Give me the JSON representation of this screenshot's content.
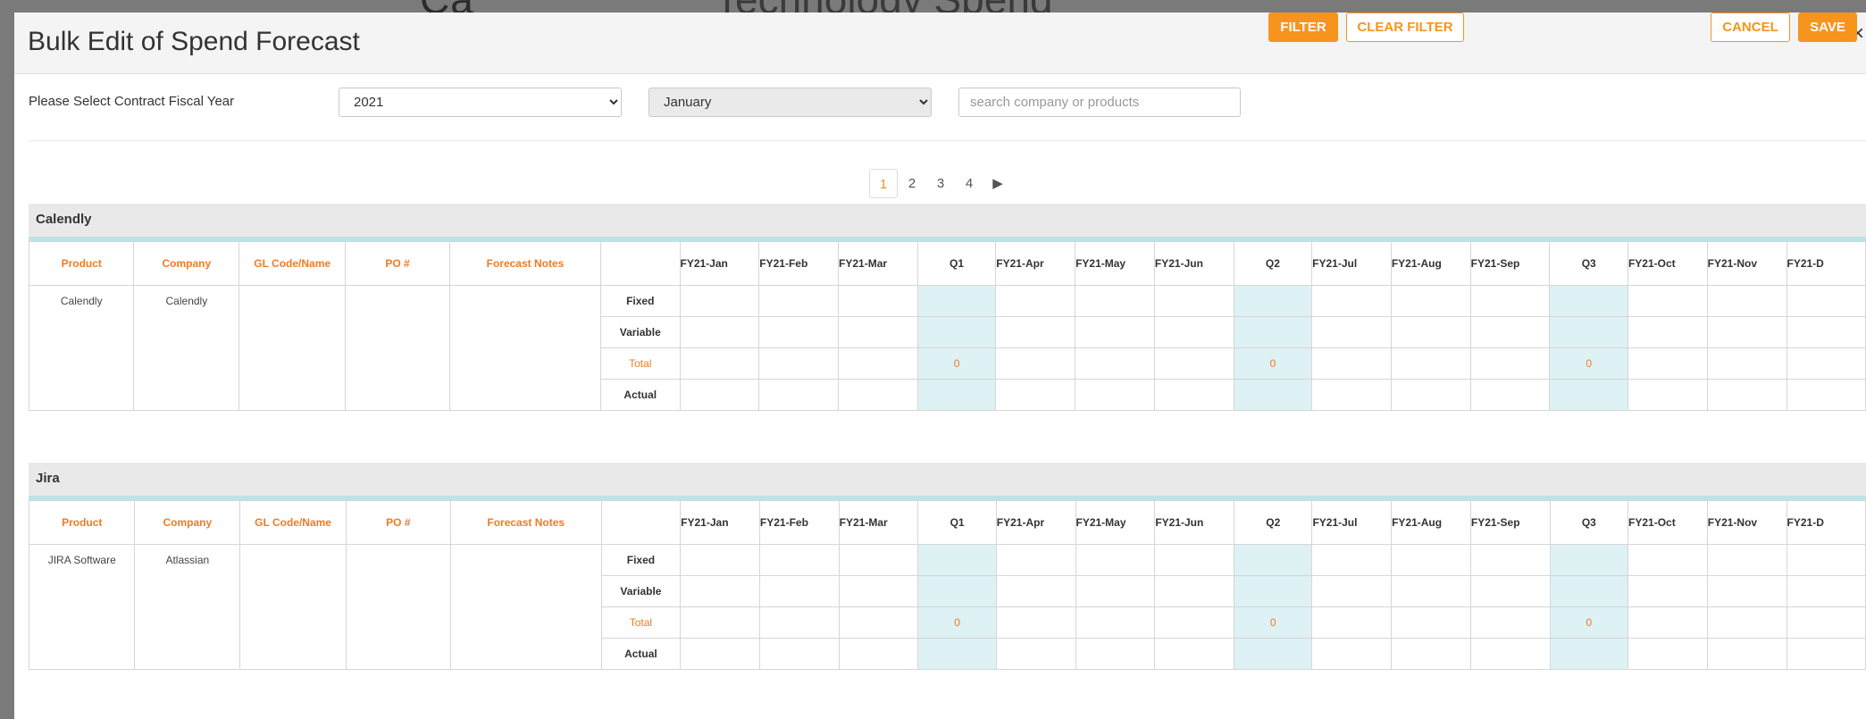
{
  "background": {
    "partial_title": "Technology Spend"
  },
  "modal": {
    "title": "Bulk Edit of Spend Forecast",
    "close_symbol": "×"
  },
  "filters": {
    "fiscal_year_label": "Please Select Contract Fiscal Year",
    "year_selected": "2021",
    "month_selected": "January",
    "search_placeholder": "search company or products",
    "filter_label": "FILTER",
    "clear_filter_label": "CLEAR FILTER",
    "cancel_label": "CANCEL",
    "save_label": "SAVE"
  },
  "pagination": {
    "pages": [
      "1",
      "2",
      "3",
      "4"
    ],
    "active": "1",
    "next_symbol": "▶"
  },
  "table_headers": {
    "info": [
      "Product",
      "Company",
      "GL Code/Name",
      "PO #",
      "Forecast Notes"
    ],
    "periods": [
      "FY21-Jan",
      "FY21-Feb",
      "FY21-Mar",
      "Q1",
      "FY21-Apr",
      "FY21-May",
      "FY21-Jun",
      "Q2",
      "FY21-Jul",
      "FY21-Aug",
      "FY21-Sep",
      "Q3",
      "FY21-Oct",
      "FY21-Nov",
      "FY21-D"
    ]
  },
  "row_labels": [
    "Fixed",
    "Variable",
    "Total",
    "Actual"
  ],
  "sections": [
    {
      "name": "Calendly",
      "product": "Calendly",
      "company": "Calendly",
      "gl_code": "",
      "po_number": "",
      "forecast_notes": "",
      "quarter_totals": [
        "0",
        "0",
        "0"
      ]
    },
    {
      "name": "Jira",
      "product": "JIRA Software",
      "company": "Atlassian",
      "gl_code": "",
      "po_number": "",
      "forecast_notes": "",
      "quarter_totals": [
        "0",
        "0",
        "0"
      ]
    }
  ],
  "colors": {
    "accent": "#f7941d",
    "header_text": "#f07b24",
    "quarter_bg": "#def1f4",
    "section_rule": "#bde3e8"
  }
}
